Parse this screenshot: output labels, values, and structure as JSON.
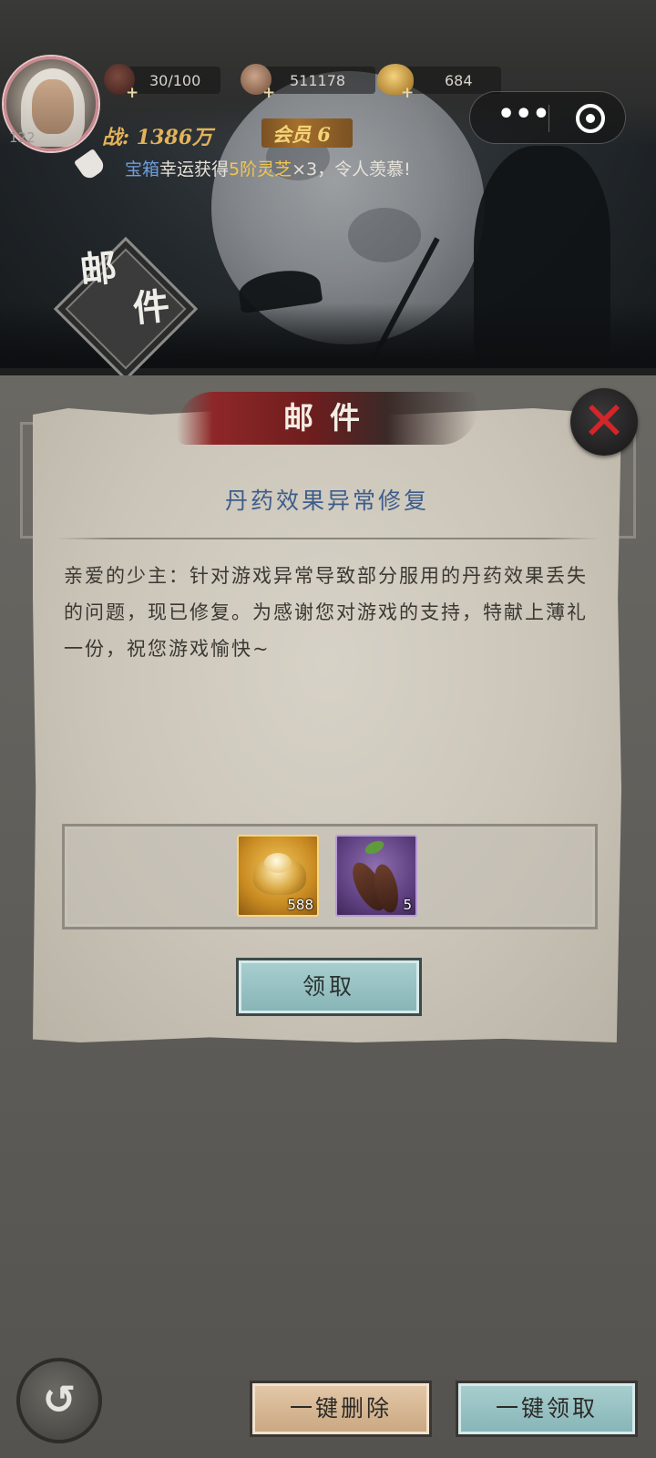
{
  "player": {
    "level": "122",
    "power": "战: 1386万",
    "vip": "会员 6"
  },
  "resources": {
    "stamina": "30/100",
    "copper": "511178",
    "gold": "684"
  },
  "broadcast": {
    "prefix": "宝箱",
    "text": "幸运获得",
    "item": "5阶灵芝",
    "suffix": "×3，令人羡慕!"
  },
  "page_title": {
    "first": "邮",
    "second": "件"
  },
  "dialog": {
    "title": "邮件",
    "subject": "丹药效果异常修复",
    "body": "亲爱的少主：针对游戏异常导致部分服用的丹药效果丢失的问题，现已修复。为感谢您对游戏的支持，特献上薄礼一份，祝您游戏愉快~",
    "rewards": [
      {
        "icon": "gold-ingot-icon",
        "count": "588"
      },
      {
        "icon": "lingzhi-root-icon",
        "count": "5"
      }
    ],
    "claim_label": "领取"
  },
  "bottom": {
    "delete_all": "一键删除",
    "claim_all": "一键领取"
  },
  "icons": {
    "close": "✕",
    "back": "↺",
    "more": "•••"
  },
  "colors": {
    "accent_red": "#d2262b",
    "gold_text": "#e2b25a",
    "subject_blue": "#3e5d8a"
  }
}
